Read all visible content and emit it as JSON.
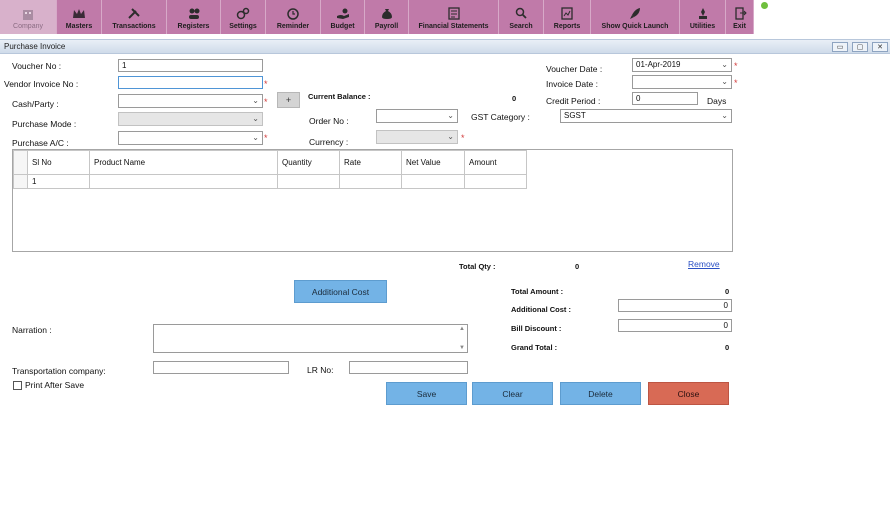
{
  "toolbar": {
    "items": [
      {
        "label": "Company",
        "icon": "building-icon"
      },
      {
        "label": "Masters",
        "icon": "crown-icon"
      },
      {
        "label": "Transactions",
        "icon": "tools-icon"
      },
      {
        "label": "Registers",
        "icon": "people-icon"
      },
      {
        "label": "Settings",
        "icon": "gears-icon"
      },
      {
        "label": "Reminder",
        "icon": "alarm-clock-icon"
      },
      {
        "label": "Budget",
        "icon": "money-hand-icon"
      },
      {
        "label": "Payroll",
        "icon": "money-bag-icon"
      },
      {
        "label": "Financial Statements",
        "icon": "statement-icon"
      },
      {
        "label": "Search",
        "icon": "search-icon"
      },
      {
        "label": "Reports",
        "icon": "reports-icon"
      },
      {
        "label": "Show Quick Launch",
        "icon": "rocket-icon"
      },
      {
        "label": "Utilities",
        "icon": "utilities-icon"
      },
      {
        "label": "Exit",
        "icon": "exit-icon"
      }
    ]
  },
  "window": {
    "title": "Purchase Invoice",
    "minimize": "▭",
    "restore": "▢",
    "close": "✕"
  },
  "form": {
    "voucher_no_label": "Voucher No :",
    "voucher_no_value": "1",
    "vendor_invoice_label": "Vendor Invoice No :",
    "vendor_invoice_value": "",
    "cash_party_label": "Cash/Party :",
    "purchase_mode_label": "Purchase Mode :",
    "purchase_ac_label": "Purchase A/C :",
    "plus_label": "+",
    "current_balance_label": "Current Balance :",
    "current_balance_value": "0",
    "order_no_label": "Order No :",
    "currency_label": "Currency :",
    "gst_category_label": "GST Category :",
    "gst_category_value": "SGST",
    "voucher_date_label": "Voucher Date :",
    "voucher_date_value": "01-Apr-2019",
    "invoice_date_label": "Invoice Date :",
    "credit_period_label": "Credit Period :",
    "credit_period_value": "0",
    "days_label": "Days",
    "required_mark": "*"
  },
  "grid": {
    "columns": [
      "Sl No",
      "Product Name",
      "Quantity",
      "Rate",
      "Net Value",
      "Amount"
    ],
    "rows": [
      [
        "1",
        "",
        "",
        "",
        "",
        ""
      ]
    ]
  },
  "totals": {
    "total_qty_label": "Total Qty :",
    "total_qty_value": "0",
    "remove_label": "Remove",
    "total_amount_label": "Total Amount :",
    "total_amount_value": "0",
    "additional_cost_label": "Additional Cost :",
    "additional_cost_value": "0",
    "bill_discount_label": "Bill Discount :",
    "bill_discount_value": "0",
    "grand_total_label": "Grand Total :",
    "grand_total_value": "0"
  },
  "bottom": {
    "additional_cost_button": "Additional Cost",
    "narration_label": "Narration :",
    "transport_label": "Transportation company:",
    "lr_no_label": "LR No:",
    "print_after_save_label": "Print After Save"
  },
  "actions": {
    "save": "Save",
    "clear": "Clear",
    "delete": "Delete",
    "close": "Close"
  },
  "colors": {
    "toolbar": "#c07aa9",
    "button_blue": "#73b3e6",
    "button_red": "#d86a55",
    "required": "#d23a3a"
  }
}
